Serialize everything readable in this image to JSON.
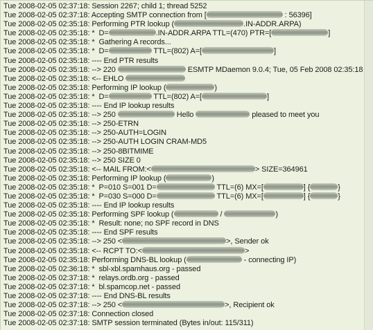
{
  "log": {
    "lines": [
      [
        "Tue 2008-02-05 02:37:18: Session 2267; child 1; thread 5252"
      ],
      [
        "Tue 2008-02-05 02:37:18: Accepting SMTP connection from [",
        {
          "r": 110
        },
        " : 56396]"
      ],
      [
        "Tue 2008-02-05 02:35:18: Performing PTR lookup (",
        {
          "r": 100
        },
        ".IN-ADDR.ARPA)"
      ],
      [
        "Tue 2008-02-05 02:35:18: *  D=",
        {
          "r": 68
        },
        ".IN-ADDR.ARPA TTL=(470) PTR=[",
        {
          "r": 82
        },
        "]"
      ],
      [
        "Tue 2008-02-05 02:35:18: *  Gathering A records..."
      ],
      [
        "Tue 2008-02-05 02:35:18: *  D=",
        {
          "r": 62
        },
        " TTL=(802) A=[",
        {
          "r": 104
        },
        "]"
      ],
      [
        "Tue 2008-02-05 02:35:18: ---- End PTR results"
      ],
      [
        "Tue 2008-02-05 02:35:18: --> 220 ",
        {
          "r": 98
        },
        " ESMTP MDaemon 9.0.4; Tue, 05 Feb 2008 02:35:18 +0200"
      ],
      [
        "Tue 2008-02-05 02:35:18: <-- EHLO ",
        {
          "r": 86
        }
      ],
      [
        "Tue 2008-02-05 02:35:18: Performing IP lookup (",
        {
          "r": 70
        },
        ")"
      ],
      [
        "Tue 2008-02-05 02:35:18: *  D=",
        {
          "r": 62
        },
        " TTL=(802) A=[",
        {
          "r": 94
        },
        "]"
      ],
      [
        "Tue 2008-02-05 02:35:18: ---- End IP lookup results"
      ],
      [
        "Tue 2008-02-05 02:35:18: --> 250 ",
        {
          "r": 82
        },
        " Hello ",
        {
          "r": 78
        },
        " pleased to meet you"
      ],
      [
        "Tue 2008-02-05 02:35:18: --> 250-ETRN"
      ],
      [
        "Tue 2008-02-05 02:35:18: --> 250-AUTH=LOGIN"
      ],
      [
        "Tue 2008-02-05 02:35:18: --> 250-AUTH LOGIN CRAM-MD5"
      ],
      [
        "Tue 2008-02-05 02:35:18: --> 250-8BITMIME"
      ],
      [
        "Tue 2008-02-05 02:35:18: --> 250 SIZE 0"
      ],
      [
        "Tue 2008-02-05 02:35:18: <-- MAIL FROM:<",
        {
          "r": 150
        },
        "> SIZE=364961"
      ],
      [
        "Tue 2008-02-05 02:35:18: Performing IP lookup (",
        {
          "r": 66
        },
        ")"
      ],
      [
        "Tue 2008-02-05 02:35:18: *  P=010 S=001 D=",
        {
          "r": 84
        },
        " TTL=(6) MX=[",
        {
          "r": 58
        },
        "] {",
        {
          "r": 40
        },
        "}"
      ],
      [
        "Tue 2008-02-05 02:35:18: *  P=030 S=000 D=",
        {
          "r": 84
        },
        " TTL=(6) MX=[",
        {
          "r": 58
        },
        "] {",
        {
          "r": 40
        },
        "}"
      ],
      [
        "Tue 2008-02-05 02:35:18: ---- End IP lookup results"
      ],
      [
        "Tue 2008-02-05 02:35:18: Performing SPF lookup (",
        {
          "r": 64
        },
        " / ",
        {
          "r": 74
        },
        ")"
      ],
      [
        "Tue 2008-02-05 02:35:18: *  Result: none; no SPF record in DNS"
      ],
      [
        "Tue 2008-02-05 02:35:18: ---- End SPF results"
      ],
      [
        "Tue 2008-02-05 02:35:18: --> 250 <",
        {
          "r": 150
        },
        ">, Sender ok"
      ],
      [
        "Tue 2008-02-05 02:35:18: <-- RCPT TO:<",
        {
          "r": 148
        },
        ">"
      ],
      [
        "Tue 2008-02-05 02:35:18: Performing DNS-BL lookup (",
        {
          "r": 80
        },
        " - connecting IP)"
      ],
      [
        "Tue 2008-02-05 02:36:18: *  sbl-xbl.spamhaus.org - passed"
      ],
      [
        "Tue 2008-02-05 02:37:18: *  relays.ordb.org - passed"
      ],
      [
        "Tue 2008-02-05 02:37:18: *  bl.spamcop.net - passed"
      ],
      [
        "Tue 2008-02-05 02:37:18: ---- End DNS-BL results"
      ],
      [
        "Tue 2008-02-05 02:37:18: --> 250 <",
        {
          "r": 148
        },
        ">, Recipient ok"
      ],
      [
        "Tue 2008-02-05 02:37:18: Connection closed"
      ],
      [
        "Tue 2008-02-05 02:37:18: SMTP session terminated (Bytes in/out: 115/311)"
      ]
    ]
  }
}
